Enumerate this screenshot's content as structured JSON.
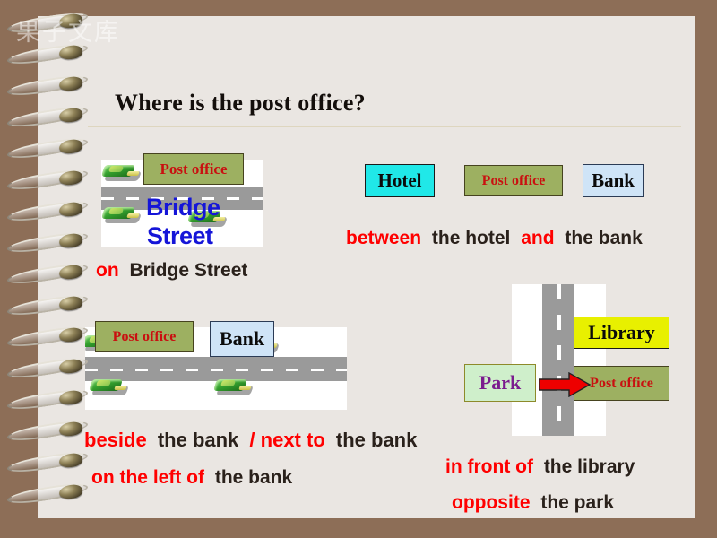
{
  "slide": {
    "title": "Where is the post office?",
    "watermark": "果子文库",
    "colors": {
      "background_border": "#8D6E57",
      "page": "#EAE6E2",
      "accent_red": "#FF0000",
      "text_dark": "#2A211B",
      "post_office_box": "#9DB061",
      "hotel_box": "#20E8E8",
      "bank_box": "#CFE4F7",
      "library_box": "#E8F000",
      "park_box": "#CFEFCB",
      "road": "#9A9A9A",
      "street_name": "#1515D8",
      "arrow": "#EE0000"
    }
  },
  "scenes": {
    "bridge_street": {
      "post_office": "Post office",
      "street_line1": "Bridge",
      "street_line2": "Street",
      "caption": {
        "highlight": "on",
        "rest": "Bridge Street"
      }
    },
    "between": {
      "hotel": "Hotel",
      "post_office": "Post office",
      "bank": "Bank",
      "caption": {
        "h1": "between",
        "t1": "the hotel",
        "h2": "and",
        "t2": "the bank"
      }
    },
    "beside": {
      "post_office": "Post office",
      "bank": "Bank",
      "caption_line1": {
        "h1": "beside",
        "t1": "the bank",
        "h2": "/ next to",
        "t2": "the bank"
      },
      "caption_line2": {
        "h1": "on the left of",
        "t1": "the bank"
      }
    },
    "in_front": {
      "library": "Library",
      "park": "Park",
      "post_office": "Post office",
      "caption_line1": {
        "h1": "in front of",
        "t1": "the library"
      },
      "caption_line2": {
        "h1": "opposite",
        "t1": "the park"
      }
    }
  }
}
